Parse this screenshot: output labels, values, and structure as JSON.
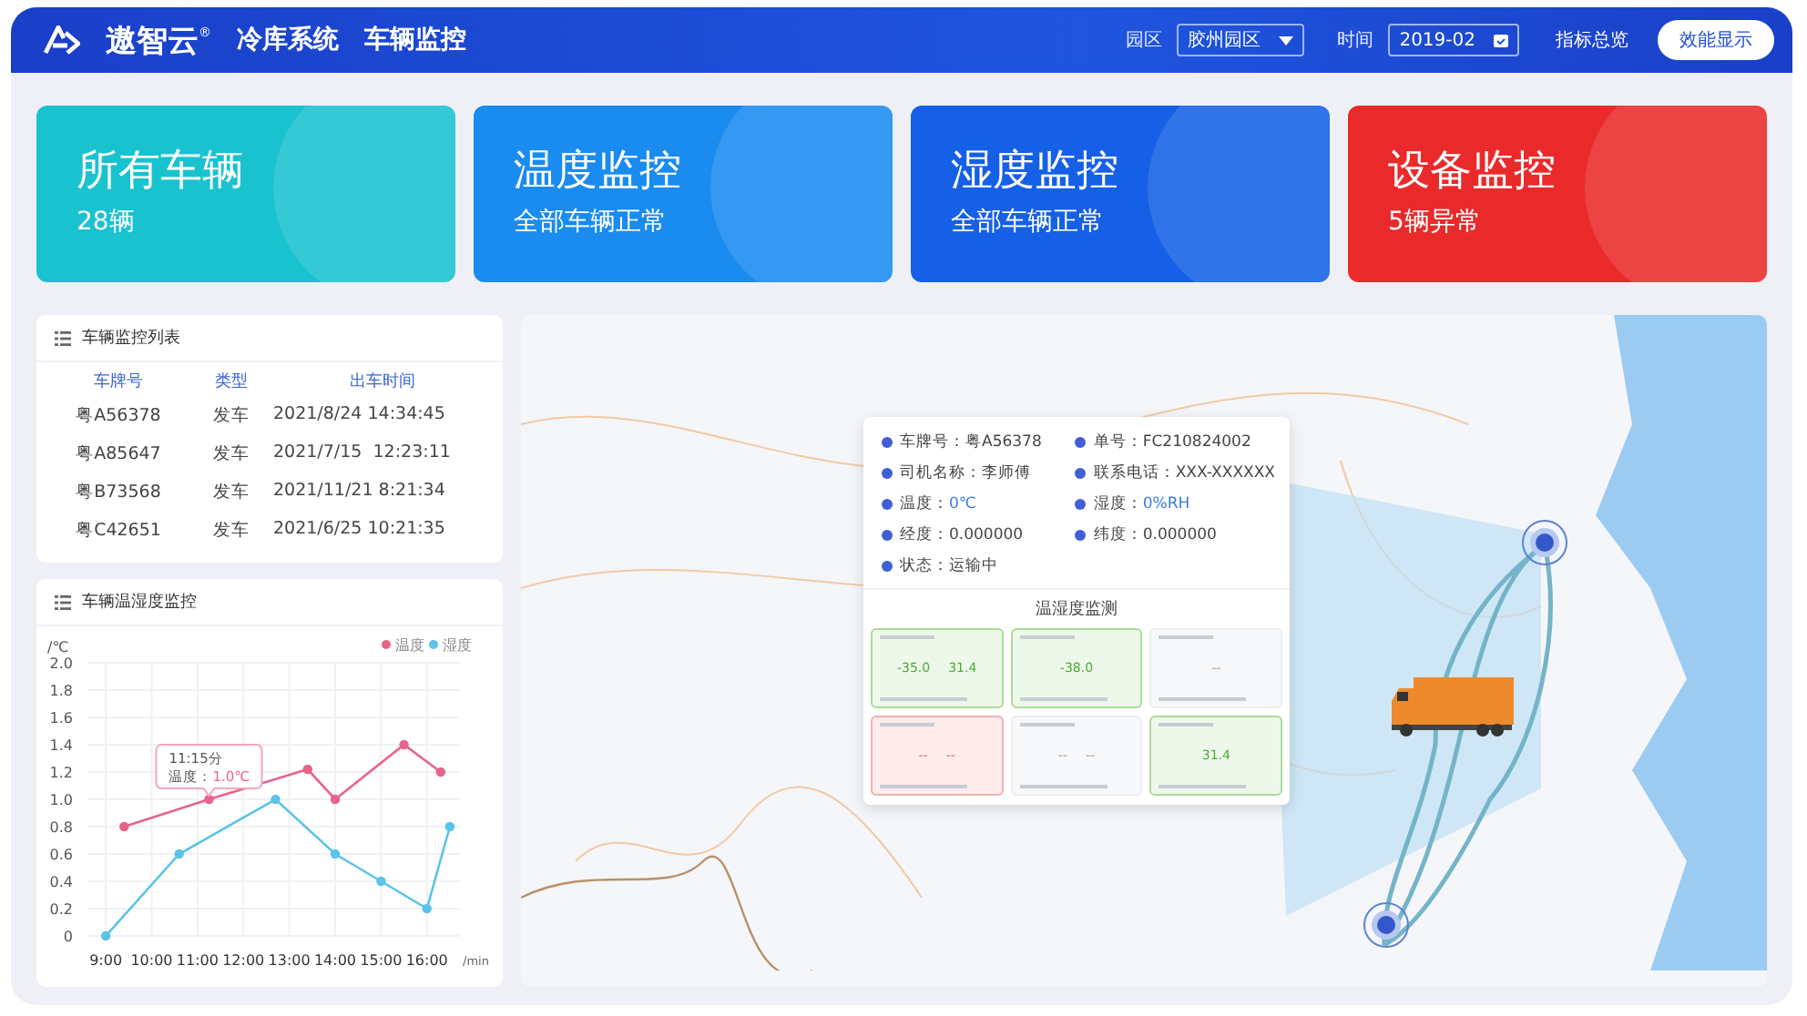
{
  "header": {
    "brand": "遨智云",
    "registered": "®",
    "system": "冷库系统",
    "page": "车辆监控",
    "filters": [
      {
        "kind": "select",
        "label": "园区",
        "value": "胶州园区"
      },
      {
        "kind": "date",
        "label": "时间",
        "value": "2019-02"
      }
    ],
    "nav": [
      {
        "label": "指标总览",
        "selected": false
      },
      {
        "label": "效能显示",
        "selected": true
      }
    ]
  },
  "summary_cards": [
    {
      "title": "所有车辆",
      "subtitle": "28辆",
      "color": "#19c2cf"
    },
    {
      "title": "温度监控",
      "subtitle": "全部车辆正常",
      "color": "#1a8bef"
    },
    {
      "title": "湿度监控",
      "subtitle": "全部车辆正常",
      "color": "#1560e6"
    },
    {
      "title": "设备监控",
      "subtitle": "5辆异常",
      "color": "#ea2a2a"
    }
  ],
  "vehicle_list": {
    "title": "车辆监控列表",
    "columns": [
      "车牌号",
      "类型",
      "出车时间"
    ],
    "rows": [
      [
        "粤A56378",
        "发车",
        "2021/8/24 14:34:45"
      ],
      [
        "粤A85647",
        "发车",
        "2021/7/15  12:23:11"
      ],
      [
        "粤B73568",
        "发车",
        "2021/11/21 8:21:34"
      ],
      [
        "粤C42651",
        "发车",
        "2021/6/25 10:21:35"
      ]
    ]
  },
  "chart_panel": {
    "title": "车辆温湿度监控",
    "chart_data": {
      "type": "line",
      "ylabel": "/℃",
      "xlabel": "/min",
      "xlim": [
        8.6,
        16.7
      ],
      "ylim": [
        0,
        2
      ],
      "xticks": [
        {
          "value": 9,
          "label": "9:00"
        },
        {
          "value": 10,
          "label": "10:00"
        },
        {
          "value": 11,
          "label": "11:00"
        },
        {
          "value": 12,
          "label": "12:00"
        },
        {
          "value": 13,
          "label": "13:00"
        },
        {
          "value": 14,
          "label": "14:00"
        },
        {
          "value": 15,
          "label": "15:00"
        },
        {
          "value": 16,
          "label": "16:00"
        }
      ],
      "yticks": [
        {
          "value": 0,
          "label": "0"
        },
        {
          "value": 0.2,
          "label": "0.2"
        },
        {
          "value": 0.4,
          "label": "0.4"
        },
        {
          "value": 0.6,
          "label": "0.6"
        },
        {
          "value": 0.8,
          "label": "0.8"
        },
        {
          "value": 1,
          "label": "1.0"
        },
        {
          "value": 1.2,
          "label": "1.2"
        },
        {
          "value": 1.4,
          "label": "1.4"
        },
        {
          "value": 1.6,
          "label": "1.6"
        },
        {
          "value": 1.8,
          "label": "1.8"
        },
        {
          "value": 2,
          "label": "2.0"
        }
      ],
      "grid": true,
      "legend": "top-right",
      "series": [
        {
          "name": "温度",
          "color": "#e8638a",
          "marker": "circle",
          "x": [
            9.4,
            11.25,
            13.4,
            14,
            15.5,
            16.3
          ],
          "values": [
            0.8,
            1.0,
            1.22,
            1.0,
            1.4,
            1.2
          ]
        },
        {
          "name": "湿度",
          "color": "#5bc3e8",
          "marker": "circle",
          "x": [
            9,
            10.6,
            12.7,
            14,
            15,
            16,
            16.5
          ],
          "values": [
            0,
            0.6,
            1.0,
            0.6,
            0.4,
            0.2,
            0.8
          ]
        }
      ],
      "annotations": [
        {
          "x": 11.25,
          "y": 1.0,
          "text": "11:15分"
        }
      ]
    },
    "tooltip": {
      "label": "温度：",
      "value": "1.0℃"
    }
  },
  "map": {
    "popup": {
      "fields": [
        {
          "label": "车牌号：",
          "value": "粤A56378",
          "highlight": false
        },
        {
          "label": "单号：",
          "value": "FC210824002",
          "highlight": false
        },
        {
          "label": "司机名称：",
          "value": "李师傅",
          "highlight": false
        },
        {
          "label": "联系电话：",
          "value": "XXX-XXXXXX",
          "highlight": false
        },
        {
          "label": "温度：",
          "value": "0℃",
          "highlight": true
        },
        {
          "label": "湿度：",
          "value": "0%RH",
          "highlight": true
        },
        {
          "label": "经度：",
          "value": "0.000000",
          "highlight": false
        },
        {
          "label": "纬度：",
          "value": "0.000000",
          "highlight": false
        },
        {
          "label": "状态：",
          "value": "运输中",
          "highlight": false
        }
      ],
      "monitor_title": "温湿度监测",
      "sensors": [
        {
          "kind": "normal",
          "readings": [
            "-35.0",
            "31.4"
          ]
        },
        {
          "kind": "normal",
          "readings": [
            "-38.0"
          ]
        },
        {
          "kind": "offline",
          "readings": [
            "--"
          ]
        },
        {
          "kind": "alarm",
          "readings": [
            "--",
            "--"
          ]
        },
        {
          "kind": "offline",
          "readings": [
            "--",
            "--"
          ]
        },
        {
          "kind": "normal",
          "readings": [
            "31.4"
          ]
        }
      ]
    }
  }
}
